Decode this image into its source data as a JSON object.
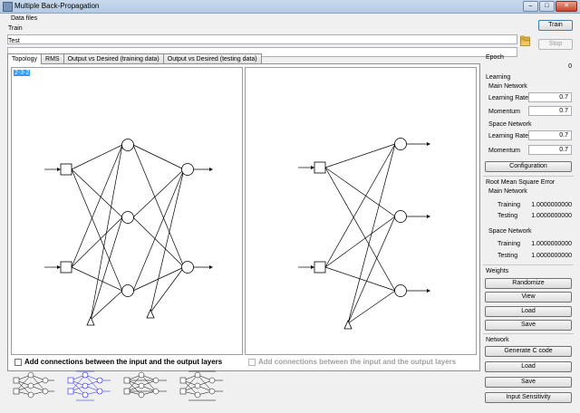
{
  "window": {
    "title": "Multiple Back-Propagation",
    "buttons": [
      "minimize",
      "maximize",
      "close"
    ]
  },
  "data_files": {
    "group_label": "Data files",
    "train_label": "Train",
    "train_value": "",
    "test_label": "Test",
    "test_value": "",
    "train_button": "Train",
    "stop_button": "Stop"
  },
  "tabs": [
    {
      "label": "Topology",
      "active": true
    },
    {
      "label": "RMS",
      "active": false
    },
    {
      "label": "Output vs Desired (training data)",
      "active": false
    },
    {
      "label": "Output vs Desired (testing data)",
      "active": false
    }
  ],
  "topology": {
    "value": "2-3-2",
    "checkbox_main_label": "Add connections between the input and the output layers",
    "checkbox_space_label": "Add connections between the input and the output layers"
  },
  "epoch": {
    "label": "Epoch",
    "value": "0"
  },
  "learning": {
    "label": "Learning",
    "main_label": "Main Network",
    "main_lr_label": "Learning Rate",
    "main_lr": "0.7",
    "main_mom_label": "Momentum",
    "main_mom": "0.7",
    "space_label": "Space Network",
    "space_lr_label": "Learning Rate",
    "space_lr": "0.7",
    "space_mom_label": "Momentum",
    "space_mom": "0.7",
    "config_button": "Configuration"
  },
  "rms": {
    "label": "Root Mean Square Error",
    "main_label": "Main Network",
    "main_training_label": "Training",
    "main_training": "1.0000000000",
    "main_testing_label": "Testing",
    "main_testing": "1.0000000000",
    "space_label": "Space Network",
    "space_training_label": "Training",
    "space_training": "1.0000000000",
    "space_testing_label": "Testing",
    "space_testing": "1.0000000000"
  },
  "weights": {
    "label": "Weights",
    "randomize": "Randomize",
    "view": "View",
    "load": "Load",
    "save": "Save"
  },
  "network": {
    "label": "Network",
    "generate": "Generate C code",
    "load": "Load",
    "save": "Save",
    "sensitivity": "Input Sensitivity"
  },
  "colors": {
    "selection": "#3399ff",
    "thumb_selected": "#1a1aff",
    "titlebar": "#c9d9ec"
  }
}
